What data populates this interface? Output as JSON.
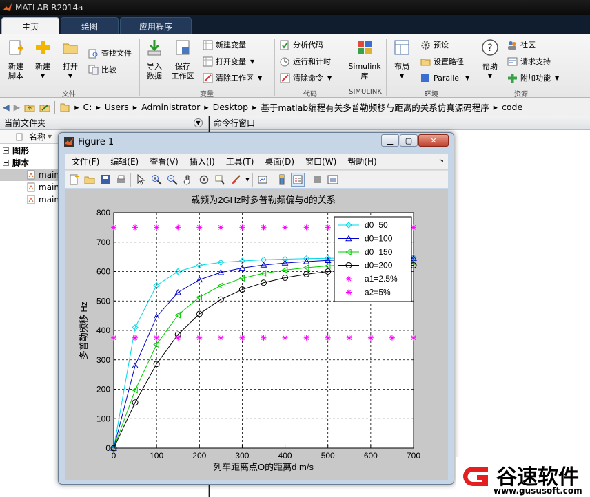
{
  "app": {
    "title": "MATLAB R2014a"
  },
  "tabs": [
    {
      "label": "主页"
    },
    {
      "label": "绘图"
    },
    {
      "label": "应用程序"
    }
  ],
  "ribbon": {
    "new_script": "新建\n脚本",
    "new": "新建",
    "open": "打开",
    "find_files": "查找文件",
    "compare": "比较",
    "file_group": "文件",
    "import": "导入\n数据",
    "save_ws": "保存\n工作区",
    "new_var": "新建变量",
    "open_var": "打开变量",
    "clear_ws": "清除工作区",
    "var_group": "变量",
    "analyze": "分析代码",
    "run_time": "运行和计时",
    "clear_cmd": "清除命令",
    "code_group": "代码",
    "simulink": "Simulink\n库",
    "simulink_group": "SIMULINK",
    "layout": "布局",
    "prefs": "预设",
    "set_path": "设置路径",
    "parallel": "Parallel",
    "env_group": "环境",
    "help": "帮助",
    "community": "社区",
    "support": "请求支持",
    "addons": "附加功能",
    "res_group": "资源"
  },
  "address": {
    "crumbs": [
      "C:",
      "Users",
      "Administrator",
      "Desktop",
      "基于matlab编程有关多普勒频移与距离的关系仿真源码程序",
      "code"
    ]
  },
  "left_panel": {
    "title": "当前文件夹",
    "col_name": "名称",
    "folders": [
      "图形",
      "脚本"
    ],
    "files": [
      "main",
      "main",
      "main"
    ]
  },
  "command_window": {
    "title": "命令行窗口"
  },
  "figure": {
    "title": "Figure 1",
    "menu": [
      "文件(F)",
      "编辑(E)",
      "查看(V)",
      "插入(I)",
      "工具(T)",
      "桌面(D)",
      "窗口(W)",
      "帮助(H)"
    ]
  },
  "chart_data": {
    "type": "line",
    "title": "载频为2GHz时多普勒频偏与d的关系",
    "xlabel": "列车距离点O的距离d m/s",
    "ylabel": "多普勒频移 Hz",
    "xlim": [
      0,
      700
    ],
    "ylim": [
      0,
      800
    ],
    "xticks": [
      0,
      100,
      200,
      300,
      400,
      500,
      600,
      700
    ],
    "yticks": [
      0,
      100,
      200,
      300,
      400,
      500,
      600,
      700,
      800
    ],
    "grid": true,
    "legend_position": "top-right",
    "x": [
      0,
      50,
      100,
      150,
      200,
      250,
      300,
      350,
      400,
      450,
      500,
      550,
      600,
      650,
      700
    ],
    "series": [
      {
        "name": "d0=50",
        "color": "#00d8e8",
        "marker": "diamond",
        "line": true,
        "values": [
          0,
          410,
          553,
          600,
          621,
          631,
          636,
          640,
          642,
          644,
          645,
          646,
          647,
          648,
          648
        ]
      },
      {
        "name": "d0=100",
        "color": "#0000cc",
        "marker": "triangle-up",
        "line": true,
        "values": [
          0,
          280,
          446,
          529,
          572,
          597,
          612,
          622,
          629,
          634,
          638,
          640,
          642,
          644,
          645
        ]
      },
      {
        "name": "d0=150",
        "color": "#00cc00",
        "marker": "triangle-left",
        "line": true,
        "values": [
          0,
          197,
          352,
          452,
          513,
          552,
          577,
          594,
          605,
          613,
          619,
          624,
          627,
          630,
          632
        ]
      },
      {
        "name": "d0=200",
        "color": "#000000",
        "marker": "circle",
        "line": true,
        "values": [
          0,
          155,
          286,
          386,
          456,
          505,
          539,
          562,
          579,
          591,
          600,
          607,
          613,
          617,
          621
        ]
      },
      {
        "name": "a1=2.5%",
        "color": "#ff00ff",
        "marker": "star",
        "line": false,
        "values": [
          750,
          750,
          750,
          750,
          750,
          750,
          750,
          750,
          750,
          750,
          750,
          750,
          750,
          750,
          750
        ]
      },
      {
        "name": "a2=5%",
        "color": "#ff00ff",
        "marker": "star",
        "line": false,
        "values": [
          375,
          375,
          375,
          375,
          375,
          375,
          375,
          375,
          375,
          375,
          375,
          375,
          375,
          375,
          375
        ]
      }
    ]
  },
  "watermark": {
    "name": "谷速软件",
    "url": "www.gususoft.com"
  }
}
